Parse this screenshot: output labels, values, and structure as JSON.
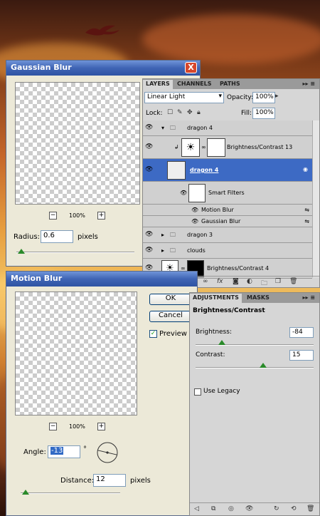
{
  "gaussian": {
    "title": "Gaussian Blur",
    "close": "X",
    "zoom_out": "−",
    "zoom_in": "+",
    "zoom": "100%",
    "radius_label": "Radius:",
    "radius_value": "0.6",
    "radius_unit": "pixels",
    "radius_slider_fraction": 0.02
  },
  "motion": {
    "title": "Motion Blur",
    "ok": "OK",
    "cancel": "Cancel",
    "preview_label": "Preview",
    "preview_checked": "✓",
    "zoom_out": "−",
    "zoom_in": "+",
    "zoom": "100%",
    "angle_label": "Angle:",
    "angle_value": "-13",
    "angle_unit": "°",
    "distance_label": "Distance:",
    "distance_value": "12",
    "distance_unit": "pixels",
    "distance_slider_fraction": 0.03
  },
  "layers": {
    "tabs": [
      "LAYERS",
      "CHANNELS",
      "PATHS"
    ],
    "menu": "▸▸ ≡",
    "blend_mode": "Linear Light",
    "opacity_label": "Opacity:",
    "opacity_value": "100%",
    "lock_label": "Lock:",
    "fill_label": "Fill:",
    "fill_value": "100%",
    "rows": [
      {
        "name": "dragon 4"
      },
      {
        "name": "Brightness/Contrast 13"
      },
      {
        "name": "dragon 4"
      },
      {
        "name": "Smart Filters"
      },
      {
        "name": "Motion Blur"
      },
      {
        "name": "Gaussian Blur"
      },
      {
        "name": "dragon 3"
      },
      {
        "name": "clouds"
      },
      {
        "name": "Brightness/Contrast 4"
      }
    ],
    "footer_icons": [
      "link-icon",
      "fx-icon",
      "mask-icon",
      "adjustment-icon",
      "folder-icon",
      "new-layer-icon",
      "trash-icon"
    ]
  },
  "adjustments": {
    "tabs": [
      "ADJUSTMENTS",
      "MASKS"
    ],
    "menu": "▸▸ ≡",
    "heading": "Brightness/Contrast",
    "brightness_label": "Brightness:",
    "brightness_value": "-84",
    "contrast_label": "Contrast:",
    "contrast_value": "15",
    "legacy_label": "Use Legacy",
    "brightness_slider_fraction": 0.24,
    "contrast_slider_fraction": 0.58
  }
}
